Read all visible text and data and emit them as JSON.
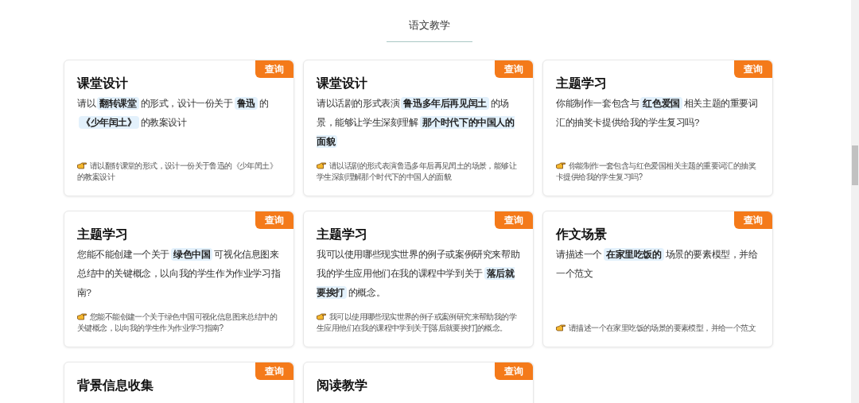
{
  "section_title": "语文教学",
  "cards": [
    {
      "badge": "查询",
      "title": "课堂设计",
      "body": [
        {
          "text": "请以",
          "highlight": false
        },
        {
          "text": "翻转课堂",
          "highlight": true
        },
        {
          "text": "的形式，设计一份关于",
          "highlight": false
        },
        {
          "text": "鲁迅",
          "highlight": true
        },
        {
          "text": "的",
          "highlight": false
        },
        {
          "text": "《少年闰土》",
          "highlight": true
        },
        {
          "text": "的教案设计",
          "highlight": false
        }
      ],
      "example": "请以翻转课堂的形式，设计一份关于鲁迅的《少年闰土》的教案设计"
    },
    {
      "badge": "查询",
      "title": "课堂设计",
      "body": [
        {
          "text": "请以话剧的形式表演",
          "highlight": false
        },
        {
          "text": "鲁迅多年后再见闰土",
          "highlight": true
        },
        {
          "text": "的场景，能够让学生深刻理解",
          "highlight": false
        },
        {
          "text": "那个时代下的中国人的面貌",
          "highlight": true
        }
      ],
      "example": "请以话剧的形式表演鲁迅多年后再见闰土的场景，能够让学生深刻理解那个时代下的中国人的面貌"
    },
    {
      "badge": "查询",
      "title": "主题学习",
      "body": [
        {
          "text": "你能制作一套包含与",
          "highlight": false
        },
        {
          "text": "红色爱国",
          "highlight": true
        },
        {
          "text": "相关主题的重要词汇的抽奖卡提供给我的学生复习吗?",
          "highlight": false
        }
      ],
      "example": "你能制作一套包含与红色爱国相关主题的重要词汇的抽奖卡提供给我的学生复习吗?"
    },
    {
      "badge": "查询",
      "title": "主题学习",
      "body": [
        {
          "text": "您能不能创建一个关于",
          "highlight": false
        },
        {
          "text": "绿色中国",
          "highlight": true
        },
        {
          "text": "可视化信息图来总结中的关键概念，以向我的学生作为作业学习指南?",
          "highlight": false
        }
      ],
      "example": "您能不能创建一个关于绿色中国可视化信息图来总结中的关键概念，以向我的学生作为作业学习指南?"
    },
    {
      "badge": "查询",
      "title": "主题学习",
      "body": [
        {
          "text": "我可以使用哪些现实世界的例子或案例研究来帮助我的学生应用他们在我的课程中学到关于",
          "highlight": false
        },
        {
          "text": "落后就要挨打",
          "highlight": true
        },
        {
          "text": "的概念。",
          "highlight": false
        }
      ],
      "example": "我可以使用哪些现实世界的例子或案例研究来帮助我的学生应用他们在我的课程中学到关于[落后就要挨打]的概念。"
    },
    {
      "badge": "查询",
      "title": "作文场景",
      "body": [
        {
          "text": "请描述一个",
          "highlight": false
        },
        {
          "text": "在家里吃饭的",
          "highlight": true
        },
        {
          "text": "场景的要素模型，并给一个范文",
          "highlight": false
        }
      ],
      "example": "请描述一个在家里吃饭的场景的要素模型，并给一个范文"
    },
    {
      "badge": "查询",
      "title": "背景信息收集"
    },
    {
      "badge": "查询",
      "title": "阅读教学"
    }
  ]
}
